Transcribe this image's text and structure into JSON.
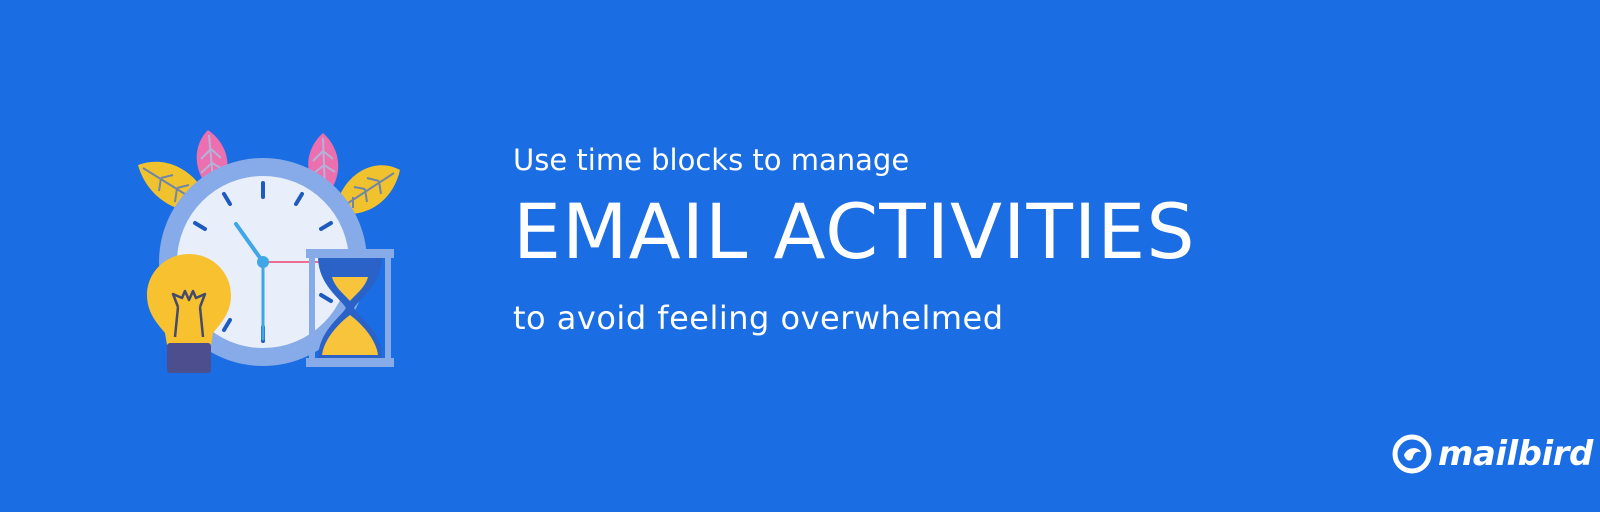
{
  "banner": {
    "subtitle_top": "Use time blocks to manage",
    "headline": "EMAIL ACTIVITIES",
    "subtitle_bottom": "to avoid feeling overwhelmed"
  },
  "brand": {
    "name": "mailbird"
  },
  "illustration": {
    "items": [
      "leaf-icon",
      "clock-icon",
      "light-bulb-icon",
      "hourglass-icon"
    ]
  },
  "colors": {
    "background": "#1a6de2",
    "text": "#ffffff",
    "clock_ring": "#87abe8",
    "clock_face": "#e8effa",
    "bulb": "#f7c12f",
    "leaf_yellow": "#f0c22e",
    "leaf_pink": "#ec6fb0",
    "hourglass_sand": "#f7c43c"
  }
}
